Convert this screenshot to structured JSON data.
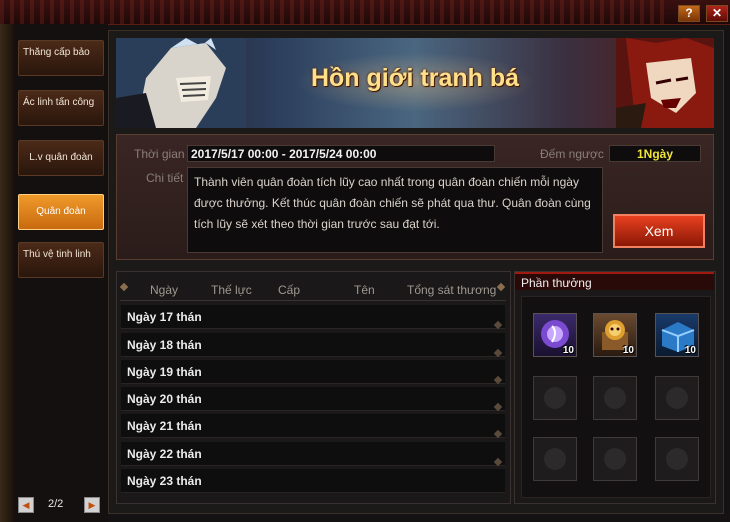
{
  "window": {
    "help_label": "?",
    "close_label": "✕",
    "accent": "#c83a16"
  },
  "sidebar": {
    "items": [
      {
        "label": "Thăng cấp bảo"
      },
      {
        "label": "Ác linh tấn công"
      },
      {
        "label": "L.v quân đoàn"
      },
      {
        "label": "Quân đoàn"
      },
      {
        "label": "Thú vệ tinh linh"
      }
    ],
    "pager": {
      "prev_icon": "arrow-left-icon",
      "next_icon": "arrow-right-icon",
      "text": "2/2"
    }
  },
  "banner": {
    "title": "Hồn giới tranh bá"
  },
  "event": {
    "time_label": "Thời gian",
    "time_value": "2017/5/17 00:00 - 2017/5/24 00:00",
    "countdown_label": "Đếm ngược",
    "countdown_value": "1Ngày",
    "detail_label": "Chi tiết",
    "detail_text": "Thành viên quân đoàn tích lũy cao nhất trong quân đoàn chiến mỗi ngày được thưởng. Kết thúc quân đoàn chiến sẽ phát qua thư. Quân đoàn cùng tích lũy sẽ xét theo thời gian trước sau đạt tới.",
    "view_button": "Xem"
  },
  "table": {
    "columns": [
      "Ngày",
      "Thế lực",
      "Cấp",
      "Tên",
      "Tổng sát thương"
    ],
    "rows": [
      "Ngày 17 thán",
      "Ngày 18 thán",
      "Ngày 19 thán",
      "Ngày 20 thán",
      "Ngày 21 thán",
      "Ngày 22 thán",
      "Ngày 23 thán"
    ]
  },
  "rewards": {
    "title": "Phần thưởng",
    "items": [
      {
        "icon": "purple-orb-icon",
        "qty": "10"
      },
      {
        "icon": "lion-chest-icon",
        "qty": "10"
      },
      {
        "icon": "blue-box-icon",
        "qty": "10"
      }
    ],
    "empty_slots": 6
  }
}
